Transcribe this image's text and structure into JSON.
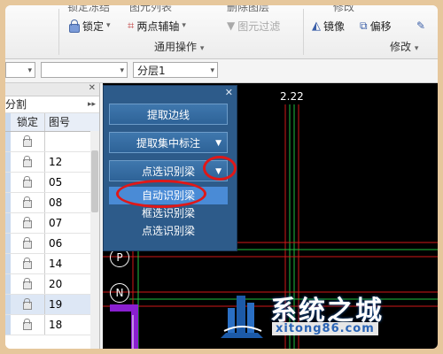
{
  "ribbon": {
    "top_strip": [
      "锁定冻结",
      "图元列表",
      "删除图层",
      "修改"
    ],
    "lock": "锁定",
    "two_point_axis": "两点辅轴",
    "element_filter": "图元过滤",
    "group_common": "通用操作",
    "mirror": "镜像",
    "offset": "偏移",
    "group_modify": "修改"
  },
  "toolbar2": {
    "combo1": "",
    "combo2": "",
    "combo3": "分层1"
  },
  "left_panel": {
    "tool_label": "分割",
    "col_lock": "锁定",
    "col_fig": "图号",
    "rows": [
      "",
      "12",
      "05",
      "08",
      "07",
      "06",
      "14",
      "20",
      "19",
      "18"
    ]
  },
  "canvas": {
    "top_axis": "2.22",
    "axis_p": "P",
    "axis_n": "N"
  },
  "dialog": {
    "extract_edge": "提取边线",
    "extract_centralized": "提取集中标注",
    "point_select_beam": "点选识别梁",
    "menu": [
      "自动识别梁",
      "框选识别梁",
      "点选识别梁"
    ]
  },
  "watermark": {
    "brand": "系统之城",
    "url": "xitong86.com"
  },
  "colors": {
    "accent_red": "#e01818",
    "dialog_blue": "#2d5b8a",
    "highlight": "#4a8bd6",
    "grid_red": "#d01818",
    "grid_green": "#1fbf3f",
    "brace_purple": "#8a1fd0"
  }
}
